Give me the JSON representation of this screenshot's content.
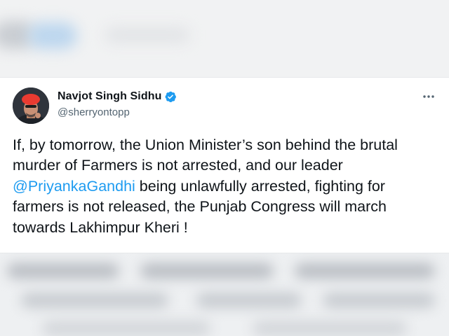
{
  "tweet": {
    "author_name": "Navjot Singh Sidhu",
    "author_handle": "@sherryontopp",
    "verified": true,
    "text_part1": "If, by tomorrow, the Union Minister’s son behind the brutal murder of Farmers is not arrested, and our leader ",
    "mention": "@PriyankaGandhi",
    "text_part2": " being unlawfully arrested, fighting for farmers is not released, the Punjab Congress will march towards Lakhimpur Kheri !"
  },
  "icons": {
    "verified": "verified-badge-icon",
    "more": "more-options-icon"
  },
  "colors": {
    "link": "#1d9bf0",
    "text": "#0f1419",
    "muted": "#536471",
    "verified": "#1d9bf0"
  }
}
